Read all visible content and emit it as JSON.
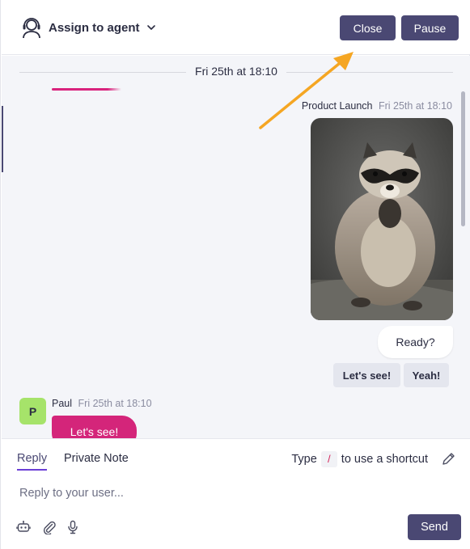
{
  "header": {
    "assign_label": "Assign to agent",
    "close_label": "Close",
    "pause_label": "Pause"
  },
  "chat": {
    "date_divider": "Fri 25th at 18:10",
    "bot_message": {
      "sender": "Product Launch",
      "time": "Fri 25th at 18:10",
      "image_alt": "raccoon",
      "text": "Ready?",
      "quick_replies": [
        "Let's see!",
        "Yeah!"
      ]
    },
    "user_message": {
      "avatar_initial": "P",
      "sender": "Paul",
      "time": "Fri 25th at 18:10",
      "text": "Let's see!"
    }
  },
  "composer": {
    "tabs": [
      "Reply",
      "Private Note"
    ],
    "active_tab": "Reply",
    "shortcut_prefix": "Type",
    "shortcut_key": "/",
    "shortcut_suffix": "to use a shortcut",
    "placeholder": "Reply to your user...",
    "send_label": "Send"
  },
  "colors": {
    "primary": "#4a4873",
    "user_bubble": "#d4257a",
    "avatar": "#a6e36a",
    "annotation_arrow": "#f5a623",
    "active_tab_underline": "#6b3fd6"
  }
}
